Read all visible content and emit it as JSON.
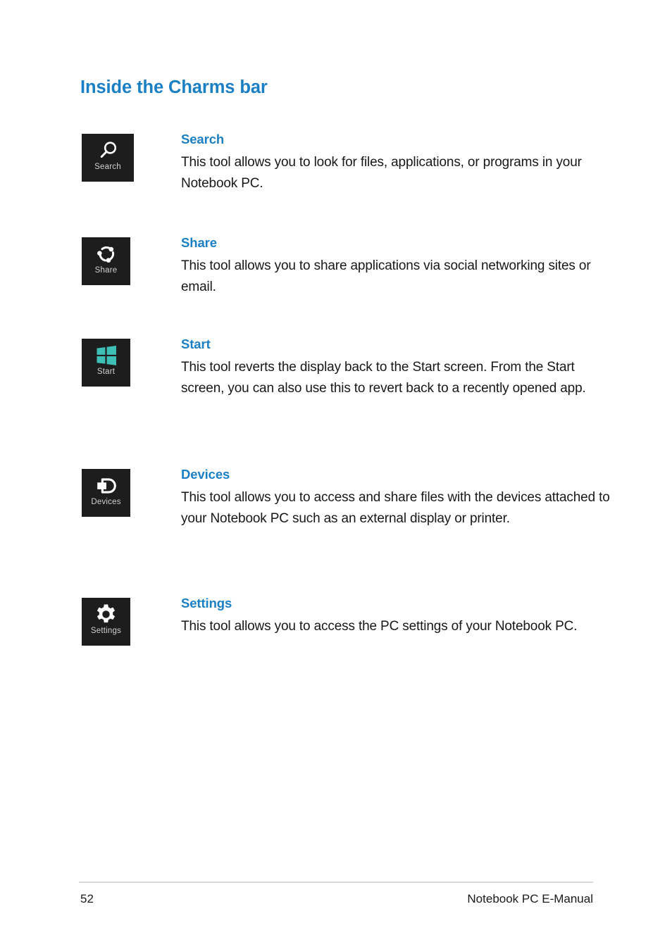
{
  "page": {
    "heading": "Inside the Charms bar",
    "accent_color": "#1b7fc4",
    "tile_background": "#1d1d1d",
    "start_logo_color": "#3dbfb5",
    "background_color": "#ffffff"
  },
  "entries": [
    {
      "icon": "search-icon",
      "tile_label": "Search",
      "title": "Search",
      "body": "This tool allows you to look for files, applications, or programs in your Notebook PC."
    },
    {
      "icon": "share-icon",
      "tile_label": "Share",
      "title": "Share",
      "body": "This tool allows you to share applications via social networking sites or email."
    },
    {
      "icon": "start-windows-logo-icon",
      "tile_label": "Start",
      "title": "Start",
      "body": "This tool reverts the display back to the Start screen. From the Start screen, you can also use this to revert back to a recently opened app."
    },
    {
      "icon": "devices-icon",
      "tile_label": "Devices",
      "title": "Devices",
      "body": "This tool allows you to access and share files with the devices attached to your Notebook PC such as an external display or printer."
    },
    {
      "icon": "settings-gear-icon",
      "tile_label": "Settings",
      "title": "Settings",
      "body": "This tool allows you to access the PC settings of your Notebook PC."
    }
  ],
  "footer": {
    "page_number": "52",
    "document_title": "Notebook PC E-Manual"
  }
}
